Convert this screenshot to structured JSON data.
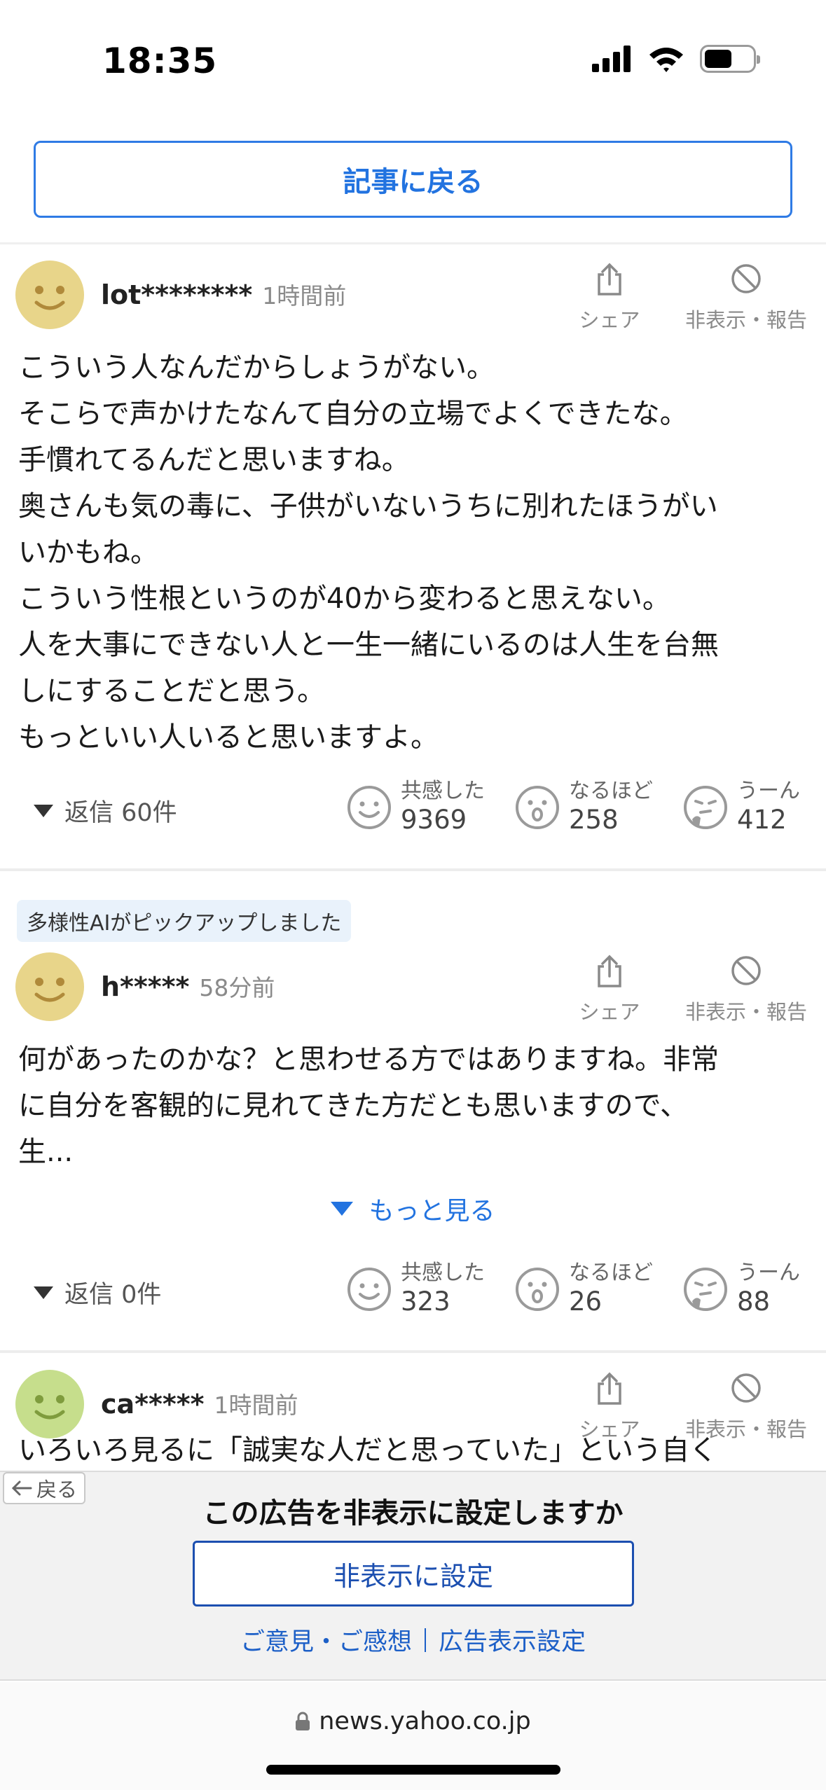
{
  "status_bar": {
    "time": "18:35"
  },
  "header": {
    "back_label": "記事に戻る"
  },
  "comments": [
    {
      "username": "lot********",
      "time": "1時間前",
      "share_label": "シェア",
      "hide_label": "非表示・報告",
      "body": "こういう人なんだからしょうがない。\nそこらで声かけたなんて自分の立場でよくできたな。\n手慣れてるんだと思いますね。\n奥さんも気の毒に、子供がいないうちに別れたほうがい\nいかもね。\nこういう性根というのが40から変わると思えない。\n人を大事にできない人と一生一緒にいるのは人生を台無\nしにすることだと思う。\nもっといい人いると思いますよ。",
      "replies": "返信 60件",
      "reactions": [
        {
          "label": "共感した",
          "count": "9369",
          "icon": "smile-icon"
        },
        {
          "label": "なるほど",
          "count": "258",
          "icon": "surprised-icon"
        },
        {
          "label": "うーん",
          "count": "412",
          "icon": "thinking-icon"
        }
      ],
      "avatar_color": "#e8d58a"
    },
    {
      "badge": "多様性AIがピックアップしました",
      "username": "h*****",
      "time": "58分前",
      "share_label": "シェア",
      "hide_label": "非表示・報告",
      "body": "何があったのかな？と思わせる方ではありますね。非常\nに自分を客観的に見れてきた方だとも思いますので、\n生...",
      "more_label": "もっと見る",
      "replies": "返信 0件",
      "reactions": [
        {
          "label": "共感した",
          "count": "323",
          "icon": "smile-icon"
        },
        {
          "label": "なるほど",
          "count": "26",
          "icon": "surprised-icon"
        },
        {
          "label": "うーん",
          "count": "88",
          "icon": "thinking-icon"
        }
      ],
      "avatar_color": "#e8d58a"
    },
    {
      "username": "ca*****",
      "time": "1時間前",
      "share_label": "シェア",
      "hide_label": "非表示・報告",
      "peek_text": "いろいろ見るに「誠実な人だと思っていた」という自く",
      "avatar_color": "#c6de8c"
    }
  ],
  "ad_overlay": {
    "back_label": "戻る",
    "title": "この広告を非表示に設定しますか",
    "hide_button": "非表示に設定",
    "feedback_link": "ご意見・ご感想",
    "settings_link": "広告表示設定"
  },
  "url_bar": {
    "url": "news.yahoo.co.jp"
  }
}
